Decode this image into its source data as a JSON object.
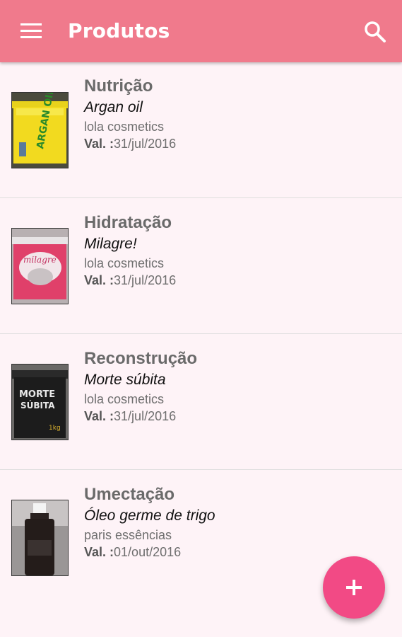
{
  "appbar": {
    "title": "Produtos",
    "menu_icon": "menu-icon",
    "search_icon": "search-icon",
    "color": "#f07a8c"
  },
  "products": [
    {
      "category": "Nutrição",
      "name": "Argan oil",
      "brand": "lola cosmetics",
      "val_label": "Val. :",
      "val_date": "31/jul/2016",
      "image": "yellow jar"
    },
    {
      "category": "Hidratação",
      "name": "Milagre!",
      "brand": "lola cosmetics",
      "val_label": "Val. :",
      "val_date": "31/jul/2016",
      "image": "pink jar"
    },
    {
      "category": "Reconstrução",
      "name": "Morte súbita",
      "brand": "lola cosmetics",
      "val_label": "Val. :",
      "val_date": "31/jul/2016",
      "image": "black jar"
    },
    {
      "category": "Umectação",
      "name": "Óleo germe de trigo",
      "brand": "paris essências",
      "val_label": "Val. :",
      "val_date": "01/out/2016",
      "image": "dark bottle"
    }
  ],
  "fab": {
    "icon": "plus-icon",
    "color": "#f24a85"
  }
}
